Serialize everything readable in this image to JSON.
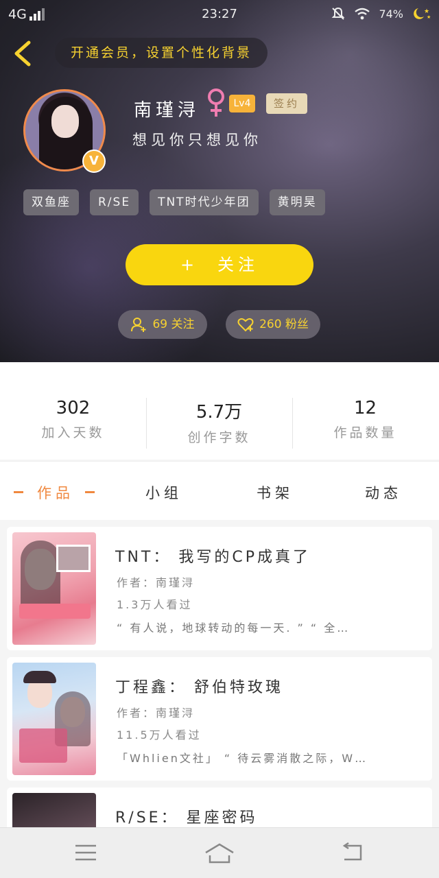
{
  "status": {
    "network": "4G",
    "time": "23:27",
    "battery": "74%",
    "icons": [
      "signal-icon",
      "mute-bell-icon",
      "wifi-icon",
      "moon-stars-icon"
    ]
  },
  "header": {
    "back_icon": "chevron-left-icon",
    "notice": "开通会员，设置个性化背景",
    "name": "南瑾浔",
    "level": "Lv4",
    "signed_badge": "签约",
    "vip_badge": "V",
    "motto": "想见你只想见你",
    "tags": [
      "双鱼座",
      "R/SE",
      "TNT时代少年团",
      "黄明昊"
    ],
    "follow_label": "关注",
    "follow_plus": "+",
    "following_count": "69 关注",
    "fans_count": "260 粉丝"
  },
  "stats": [
    {
      "value": "302",
      "label": "加入天数"
    },
    {
      "value": "5.7万",
      "label": "创作字数"
    },
    {
      "value": "12",
      "label": "作品数量"
    }
  ],
  "tabs": [
    {
      "label": "作品",
      "active": true
    },
    {
      "label": "小组",
      "active": false
    },
    {
      "label": "书架",
      "active": false
    },
    {
      "label": "动态",
      "active": false
    }
  ],
  "works": [
    {
      "title": "TNT： 我写的CP成真了",
      "author": "作者：南瑾浔",
      "views": "1.3万人看过",
      "desc": "“ 有人说，地球转动的每一天. ” “ 全…"
    },
    {
      "title": "丁程鑫： 舒伯特玫瑰",
      "author": "作者：南瑾浔",
      "views": "11.5万人看过",
      "desc": "「Whlien文社」 “ 待云雾消散之际，W…"
    },
    {
      "title": "R/SE： 星座密码"
    }
  ],
  "nav": {
    "menu_icon": "menu-icon",
    "home_icon": "home-icon",
    "back_icon": "back-arrow-icon"
  }
}
